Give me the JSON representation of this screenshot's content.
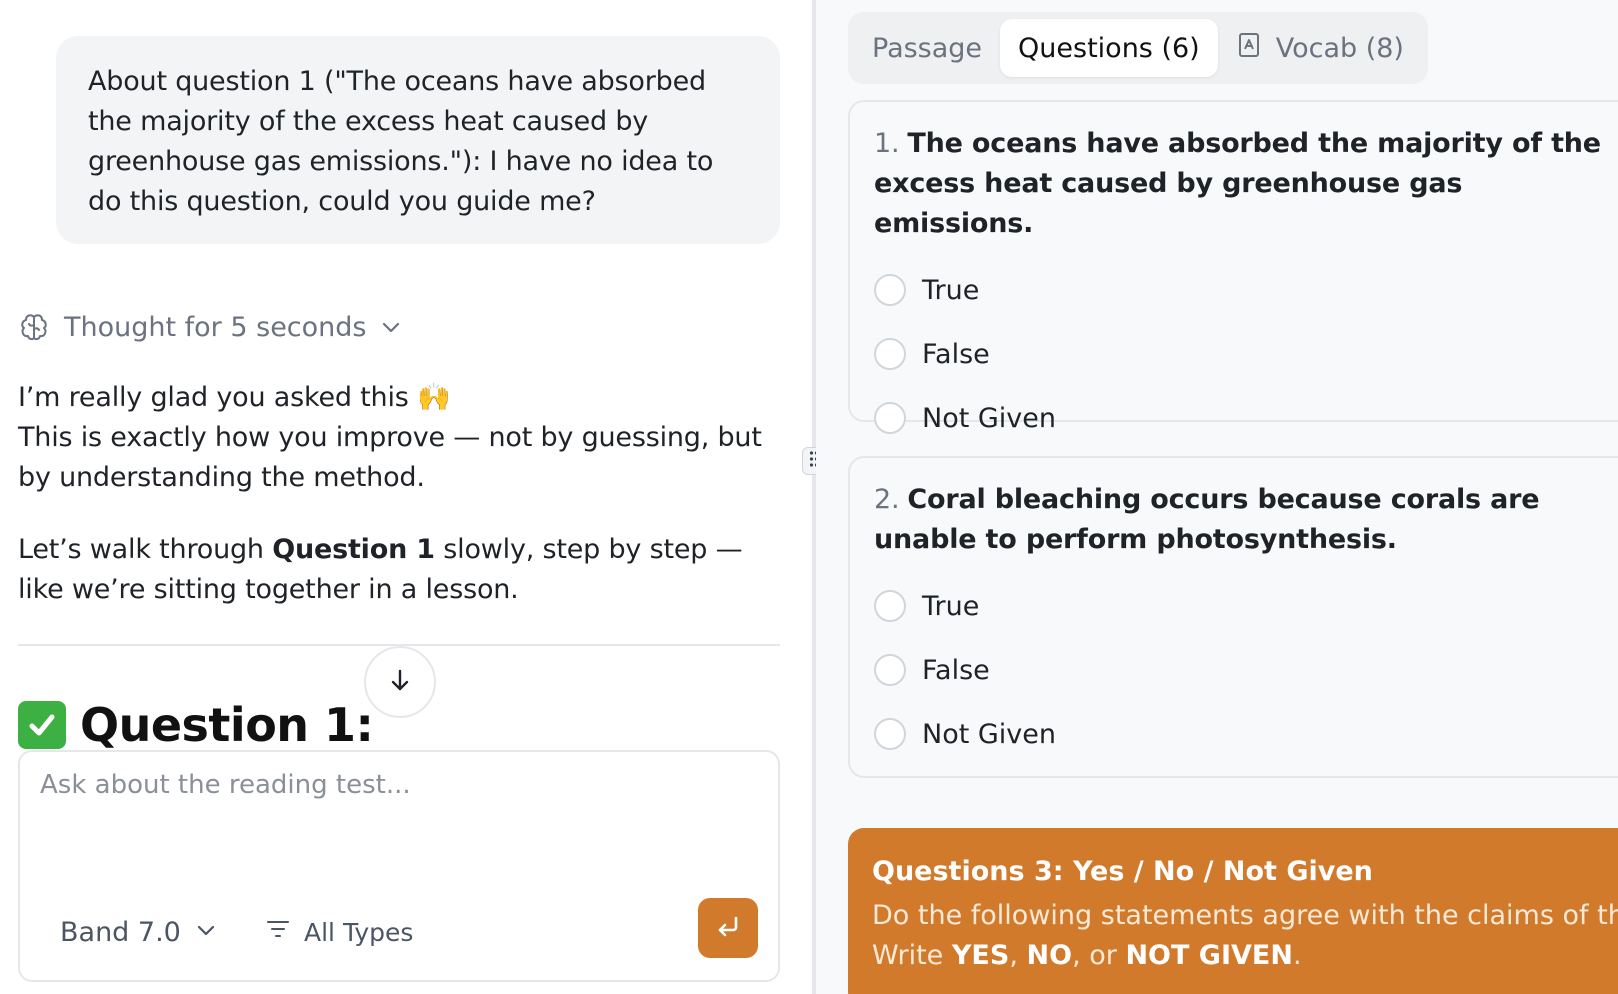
{
  "chat": {
    "user_message": "About question 1 (\"The oceans have absorbed the majority of the excess heat caused by greenhouse gas emissions.\"): I have no idea to do this question, could you guide me?",
    "thought_label": "Thought for 5 seconds",
    "reply": {
      "line1": "I’m really glad you asked this 🙌",
      "line2": "This is exactly how you improve — not by guessing, but by understanding the method.",
      "p2_before": "Let’s walk through ",
      "p2_bold": "Question 1",
      "p2_after": " slowly, step by step — like we’re sitting together in a lesson."
    },
    "heading": "Question 1:"
  },
  "composer": {
    "placeholder": "Ask about the reading test...",
    "band_label": "Band 7.0",
    "types_label": "All Types"
  },
  "tabs": [
    {
      "label": "Passage",
      "active": false
    },
    {
      "label": "Questions (6)",
      "active": true
    },
    {
      "label": "Vocab (8)",
      "active": false,
      "icon": "bookmark-icon"
    }
  ],
  "questions": [
    {
      "number": "1.",
      "text": "The oceans have absorbed the majority of the excess heat caused by greenhouse gas emissions.",
      "options": [
        "True",
        "False",
        "Not Given"
      ]
    },
    {
      "number": "2.",
      "text": "Coral bleaching occurs because corals are unable to perform photosynthesis.",
      "options": [
        "True",
        "False",
        "Not Given"
      ]
    }
  ],
  "section3": {
    "title": "Questions 3: Yes / No / Not Given",
    "line1": "Do the following statements agree with the claims of the writer?",
    "line2_prefix": "Write ",
    "yes": "YES",
    "sep1": ", ",
    "no": "NO",
    "sep2": ", or ",
    "not_given": "NOT GIVEN",
    "end": "."
  },
  "colors": {
    "accent": "#d27a2c",
    "check_green": "#3cb043",
    "bubble_bg": "#f3f4f6",
    "muted_text": "#6b7280"
  }
}
